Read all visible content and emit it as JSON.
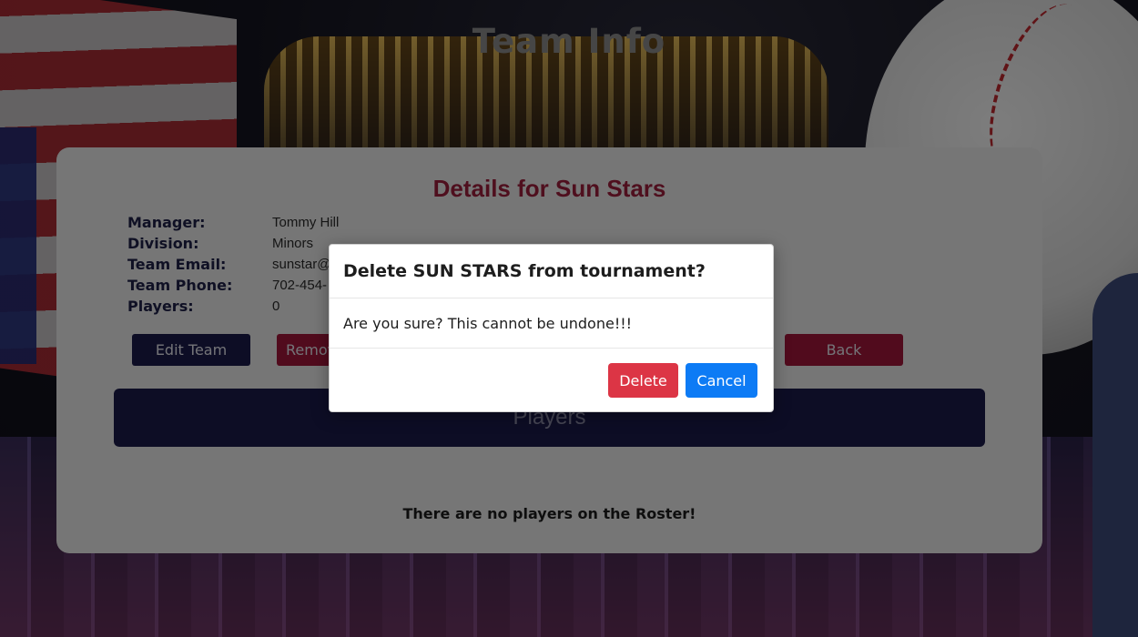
{
  "page": {
    "title": "Team Info"
  },
  "details": {
    "heading": "Details for Sun Stars",
    "fields": [
      {
        "label": "Manager:",
        "value": "Tommy Hill"
      },
      {
        "label": "Division:",
        "value": "Minors"
      },
      {
        "label": "Team Email:",
        "value": "sunstar@"
      },
      {
        "label": "Team Phone:",
        "value": "702-454-"
      },
      {
        "label": "Players:",
        "value": "0"
      }
    ]
  },
  "actions": {
    "edit_label": "Edit Team",
    "remove_label": "Remov",
    "back_label": "Back"
  },
  "players_section": {
    "label": "Players",
    "empty_message": "There are no players on the Roster!"
  },
  "modal": {
    "title": "Delete SUN STARS from tournament?",
    "message": "Are you sure? This cannot be undone!!!",
    "delete_label": "Delete",
    "cancel_label": "Cancel"
  },
  "colors": {
    "primary_navy": "#1a1b4b",
    "accent_red": "#a3173a",
    "danger": "#dc3545",
    "primary_blue": "#0d7bf5"
  }
}
